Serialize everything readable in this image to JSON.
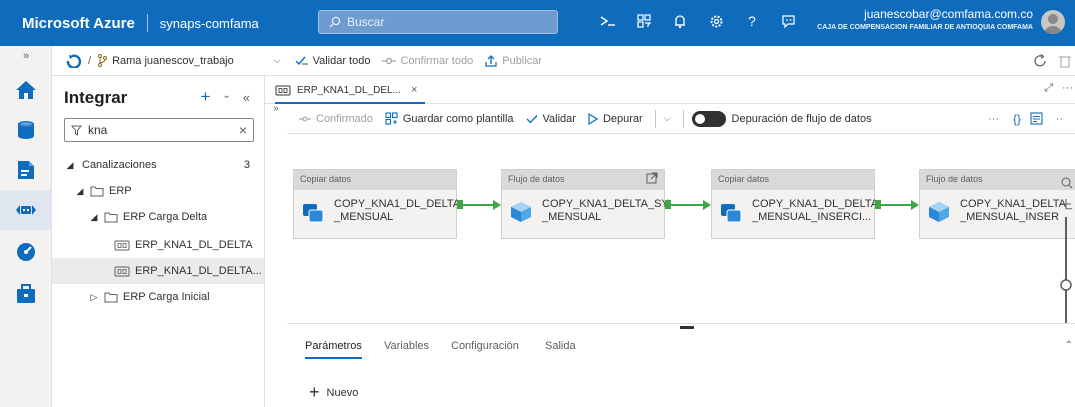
{
  "header": {
    "brand": "Microsoft Azure",
    "workspace": "synaps-comfama",
    "search_placeholder": "Buscar",
    "account_email": "juanescobar@comfama.com.co",
    "account_org": "CAJA DE COMPENSACION FAMILIAR DE ANTIOQUIA COMFAMA"
  },
  "breadcrumb": {
    "separator": "/",
    "branch": "Rama juanescov_trabajo",
    "validate_all": "Validar todo",
    "commit_all": "Confirmar todo",
    "publish": "Publicar"
  },
  "explorer": {
    "title": "Integrar",
    "filter_value": "kna",
    "tree": [
      {
        "label": "Canalizaciones",
        "count": "3"
      },
      {
        "label": "ERP"
      },
      {
        "label": "ERP Carga Delta"
      },
      {
        "label": "ERP_KNA1_DL_DELTA"
      },
      {
        "label": "ERP_KNA1_DL_DELTA..."
      },
      {
        "label": "ERP Carga Inicial"
      }
    ]
  },
  "editor": {
    "tab_label": "ERP_KNA1_DL_DEL...",
    "toolbar": {
      "confirmed": "Confirmado",
      "save_template": "Guardar como plantilla",
      "validate": "Validar",
      "debug": "Depurar",
      "dataflow_debug": "Depuración de flujo de datos",
      "more": "···"
    }
  },
  "activities": [
    {
      "type": "Copiar datos",
      "name": "COPY_KNA1_DL_DELTA\n_MENSUAL",
      "kind": "copy"
    },
    {
      "type": "Flujo de datos",
      "name": "COPY_KNA1_DELTA_SY\n_MENSUAL",
      "kind": "dataflow"
    },
    {
      "type": "Copiar datos",
      "name": "COPY_KNA1_DL_DELTA\n_MENSUAL_INSERCI...",
      "kind": "copy"
    },
    {
      "type": "Flujo de datos",
      "name": "COPY_KNA1_DELTA_\n_MENSUAL_INSER",
      "kind": "dataflow"
    }
  ],
  "panel": {
    "tabs": [
      "Parámetros",
      "Variables",
      "Configuración",
      "Salida"
    ],
    "new_label": "Nuevo"
  },
  "colors": {
    "accent": "#0f6cbd",
    "success": "#3fa548"
  }
}
